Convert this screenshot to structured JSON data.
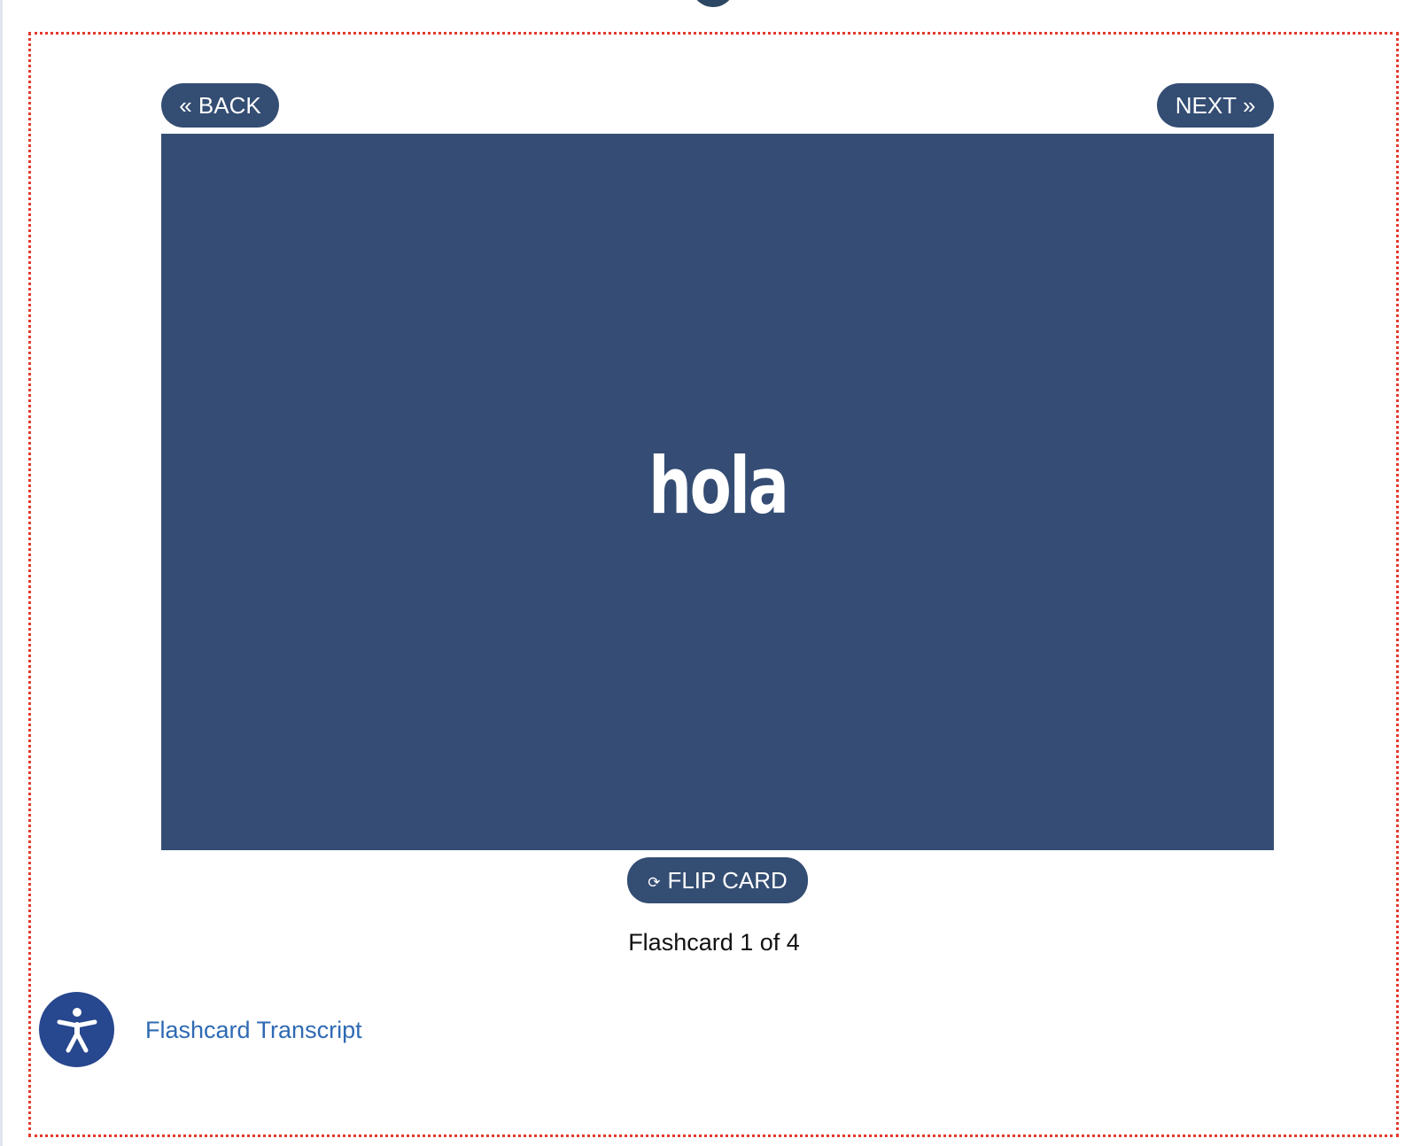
{
  "flashcard": {
    "back_label": "« BACK",
    "next_label": "NEXT »",
    "card_text": "hola",
    "flip_icon": "⟳",
    "flip_label": "FLIP CARD",
    "counter_text": "Flashcard 1 of 4",
    "current": 1,
    "total": 4
  },
  "accessibility": {
    "icon": "accessibility-person-icon"
  },
  "transcript": {
    "link_text": "Flashcard Transcript"
  },
  "colors": {
    "card_background": "#354d74",
    "button_background": "#344d73",
    "frame_border": "#e23a2b",
    "accessibility_button": "#27478e",
    "link": "#2f6ab3"
  }
}
